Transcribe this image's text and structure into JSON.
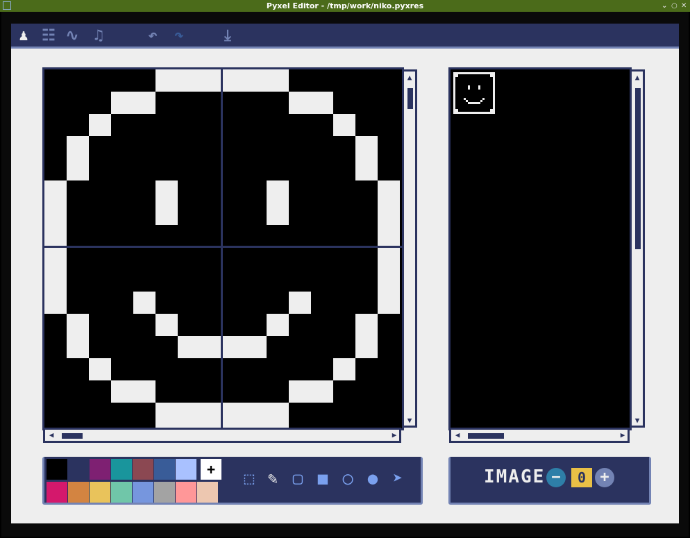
{
  "window": {
    "title": "Pyxel Editor - /tmp/work/niko.pyxres",
    "controls": [
      "⌄",
      "○",
      "✕"
    ]
  },
  "toolbar": {
    "tabs": [
      {
        "name": "image-editor",
        "icon": "sprite-icon",
        "glyph": "♟"
      },
      {
        "name": "tilemap-editor",
        "icon": "tilemap-icon",
        "glyph": "☷"
      },
      {
        "name": "sound-editor",
        "icon": "sound-wave-icon",
        "glyph": "∿"
      },
      {
        "name": "music-editor",
        "icon": "music-icon",
        "glyph": "♫"
      }
    ],
    "undo_glyph": "↶",
    "redo_glyph": "↷",
    "save_glyph": "⤓"
  },
  "palette": {
    "colors": [
      "#000000",
      "#2b335f",
      "#7e2072",
      "#19959c",
      "#8b4852",
      "#395c98",
      "#a9c1ff",
      "#eeeeee",
      "#d4186c",
      "#d38441",
      "#e9c35b",
      "#70c6a9",
      "#7696de",
      "#a3a3a3",
      "#ff9798",
      "#edc7b0"
    ],
    "add_glyph": "+"
  },
  "tools": [
    {
      "name": "select-tool",
      "glyph": "⬚"
    },
    {
      "name": "pen-tool",
      "glyph": "✎"
    },
    {
      "name": "rect-outline-tool",
      "glyph": "▢"
    },
    {
      "name": "rect-fill-tool",
      "glyph": "■"
    },
    {
      "name": "circle-outline-tool",
      "glyph": "◯"
    },
    {
      "name": "circle-fill-tool",
      "glyph": "●"
    },
    {
      "name": "bucket-tool",
      "glyph": "➤"
    }
  ],
  "image_selector": {
    "label": "IMAGE",
    "minus": "−",
    "plus": "+",
    "value": "0"
  },
  "accent": "#2b335f"
}
